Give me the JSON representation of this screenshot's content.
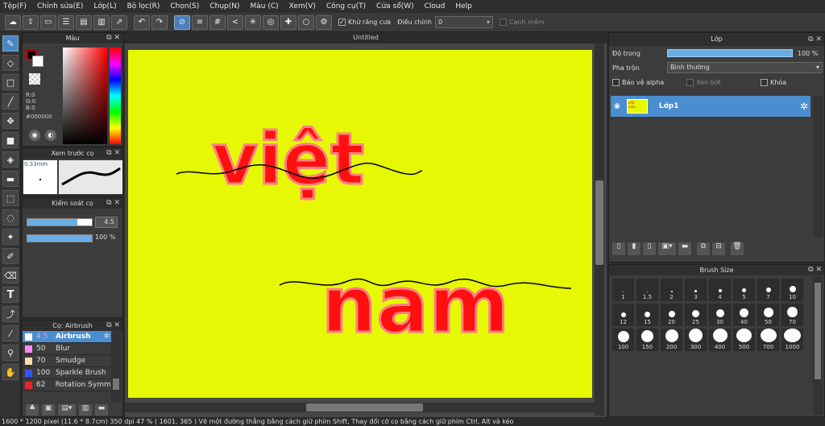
{
  "menu": [
    "Tệp(F)",
    "Chỉnh sửa(E)",
    "Lớp(L)",
    "Bộ lọc(R)",
    "Chọn(S)",
    "Chụp(N)",
    "Màu (C)",
    "Xem(V)",
    "Công cụ(T)",
    "Cửa sổ(W)",
    "Cloud",
    "Help"
  ],
  "toolbar": {
    "antialias_label": "Khử răng cưa",
    "adjust_label": "Điều chỉnh",
    "adjust_value": "0",
    "smooth_label": "Cạnh mềm"
  },
  "color_panel": {
    "title": "Màu",
    "r": "R:0",
    "g": "G:0",
    "b": "B:0",
    "hex": "#000000"
  },
  "brush_preview": {
    "title": "Xem trước cọ",
    "size": "0.33mm"
  },
  "brush_control": {
    "title": "Kiểm soát cọ",
    "size_value": "4.5",
    "opacity_value": "100 %",
    "size_fill": 0.78,
    "opacity_fill": 1.0
  },
  "brush_list": {
    "title": "Cọ: Airbrush",
    "items": [
      {
        "size": "4.5",
        "name": "Airbrush",
        "color": "#ffffff",
        "selected": true
      },
      {
        "size": "50",
        "name": "Blur",
        "color": "#ff88ff",
        "selected": false
      },
      {
        "size": "70",
        "name": "Smudge",
        "color": "#ffddaa",
        "selected": false
      },
      {
        "size": "100",
        "name": "Sparkle Brush",
        "color": "#3355ff",
        "selected": false
      },
      {
        "size": "62",
        "name": "Rotation Symme",
        "color": "#ee2222",
        "selected": false
      }
    ]
  },
  "document": {
    "tab": "Untitled",
    "text1": "việt",
    "text2": "nam"
  },
  "layer_panel": {
    "title": "Lớp",
    "opacity_label": "Độ trong",
    "opacity_value": "100 %",
    "blend_label": "Pha trộn",
    "blend_value": "Bình thường",
    "protect_alpha": "Bảo vệ alpha",
    "clip": "Xén bớt",
    "lock": "Khóa",
    "layer_name": "Lớp1",
    "thumb_text1": "việt",
    "thumb_text2": "nam"
  },
  "brush_size": {
    "title": "Brush Size",
    "sizes": [
      "1",
      "1.5",
      "2",
      "3",
      "4",
      "5",
      "7",
      "10",
      "12",
      "15",
      "20",
      "25",
      "30",
      "40",
      "50",
      "70",
      "100",
      "150",
      "200",
      "300",
      "400",
      "500",
      "700",
      "1000"
    ]
  },
  "status": "1600 * 1200 pixel  (11.6 * 8.7cm)  350 dpi  47 %  ( 1601, 365 )  Vẽ một đường thẳng bằng cách giữ phím Shift, Thay đổi cỡ cọ bằng cách giữ phím Ctrl, Alt và kéo"
}
